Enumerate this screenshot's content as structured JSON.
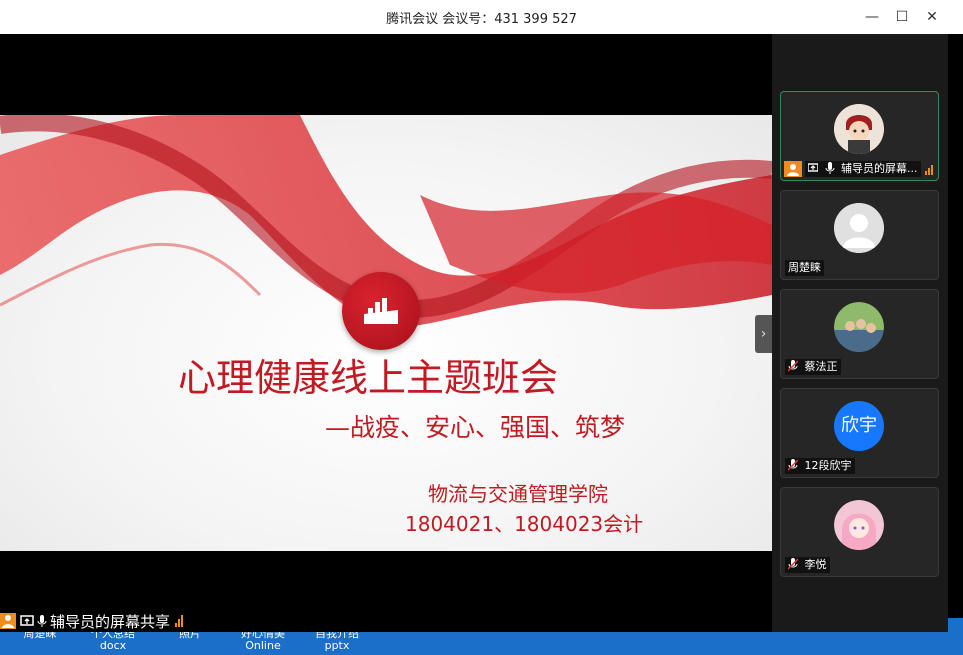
{
  "window": {
    "title": "腾讯会议 会议号：431 399 527",
    "minimize": "—",
    "maximize": "☐",
    "close": "✕"
  },
  "slide": {
    "title": "心理健康线上主题班会",
    "subtitle": "—战疫、安心、强国、筑梦",
    "school": "物流与交通管理学院",
    "classes": "1804021、1804023会计"
  },
  "sidebar": {
    "collapse_glyph": "›",
    "participants": [
      {
        "name": "辅导员的屏幕...",
        "avatar": "cartoon-avatar",
        "active": true
      },
      {
        "name": "周楚睐",
        "avatar": "default-avatar"
      },
      {
        "name": "蔡法正",
        "avatar": "group-photo-avatar",
        "muted": true
      },
      {
        "name": "12段欣宇",
        "avatar_text": "欣宇",
        "avatar_color": "#1677ff",
        "muted": true
      },
      {
        "name": "李悦",
        "avatar": "anime-avatar",
        "muted": true
      }
    ]
  },
  "share_status": "辅导员的屏幕共享",
  "desktop_labels": [
    "周楚睐",
    "个人总结\ndocx",
    "照片",
    "好心情美\nOnline",
    "自我介绍\npptx"
  ],
  "colors": {
    "accent_red": "#c21a22",
    "active_border": "#2e8b57",
    "share_orange": "#f08b1f"
  }
}
